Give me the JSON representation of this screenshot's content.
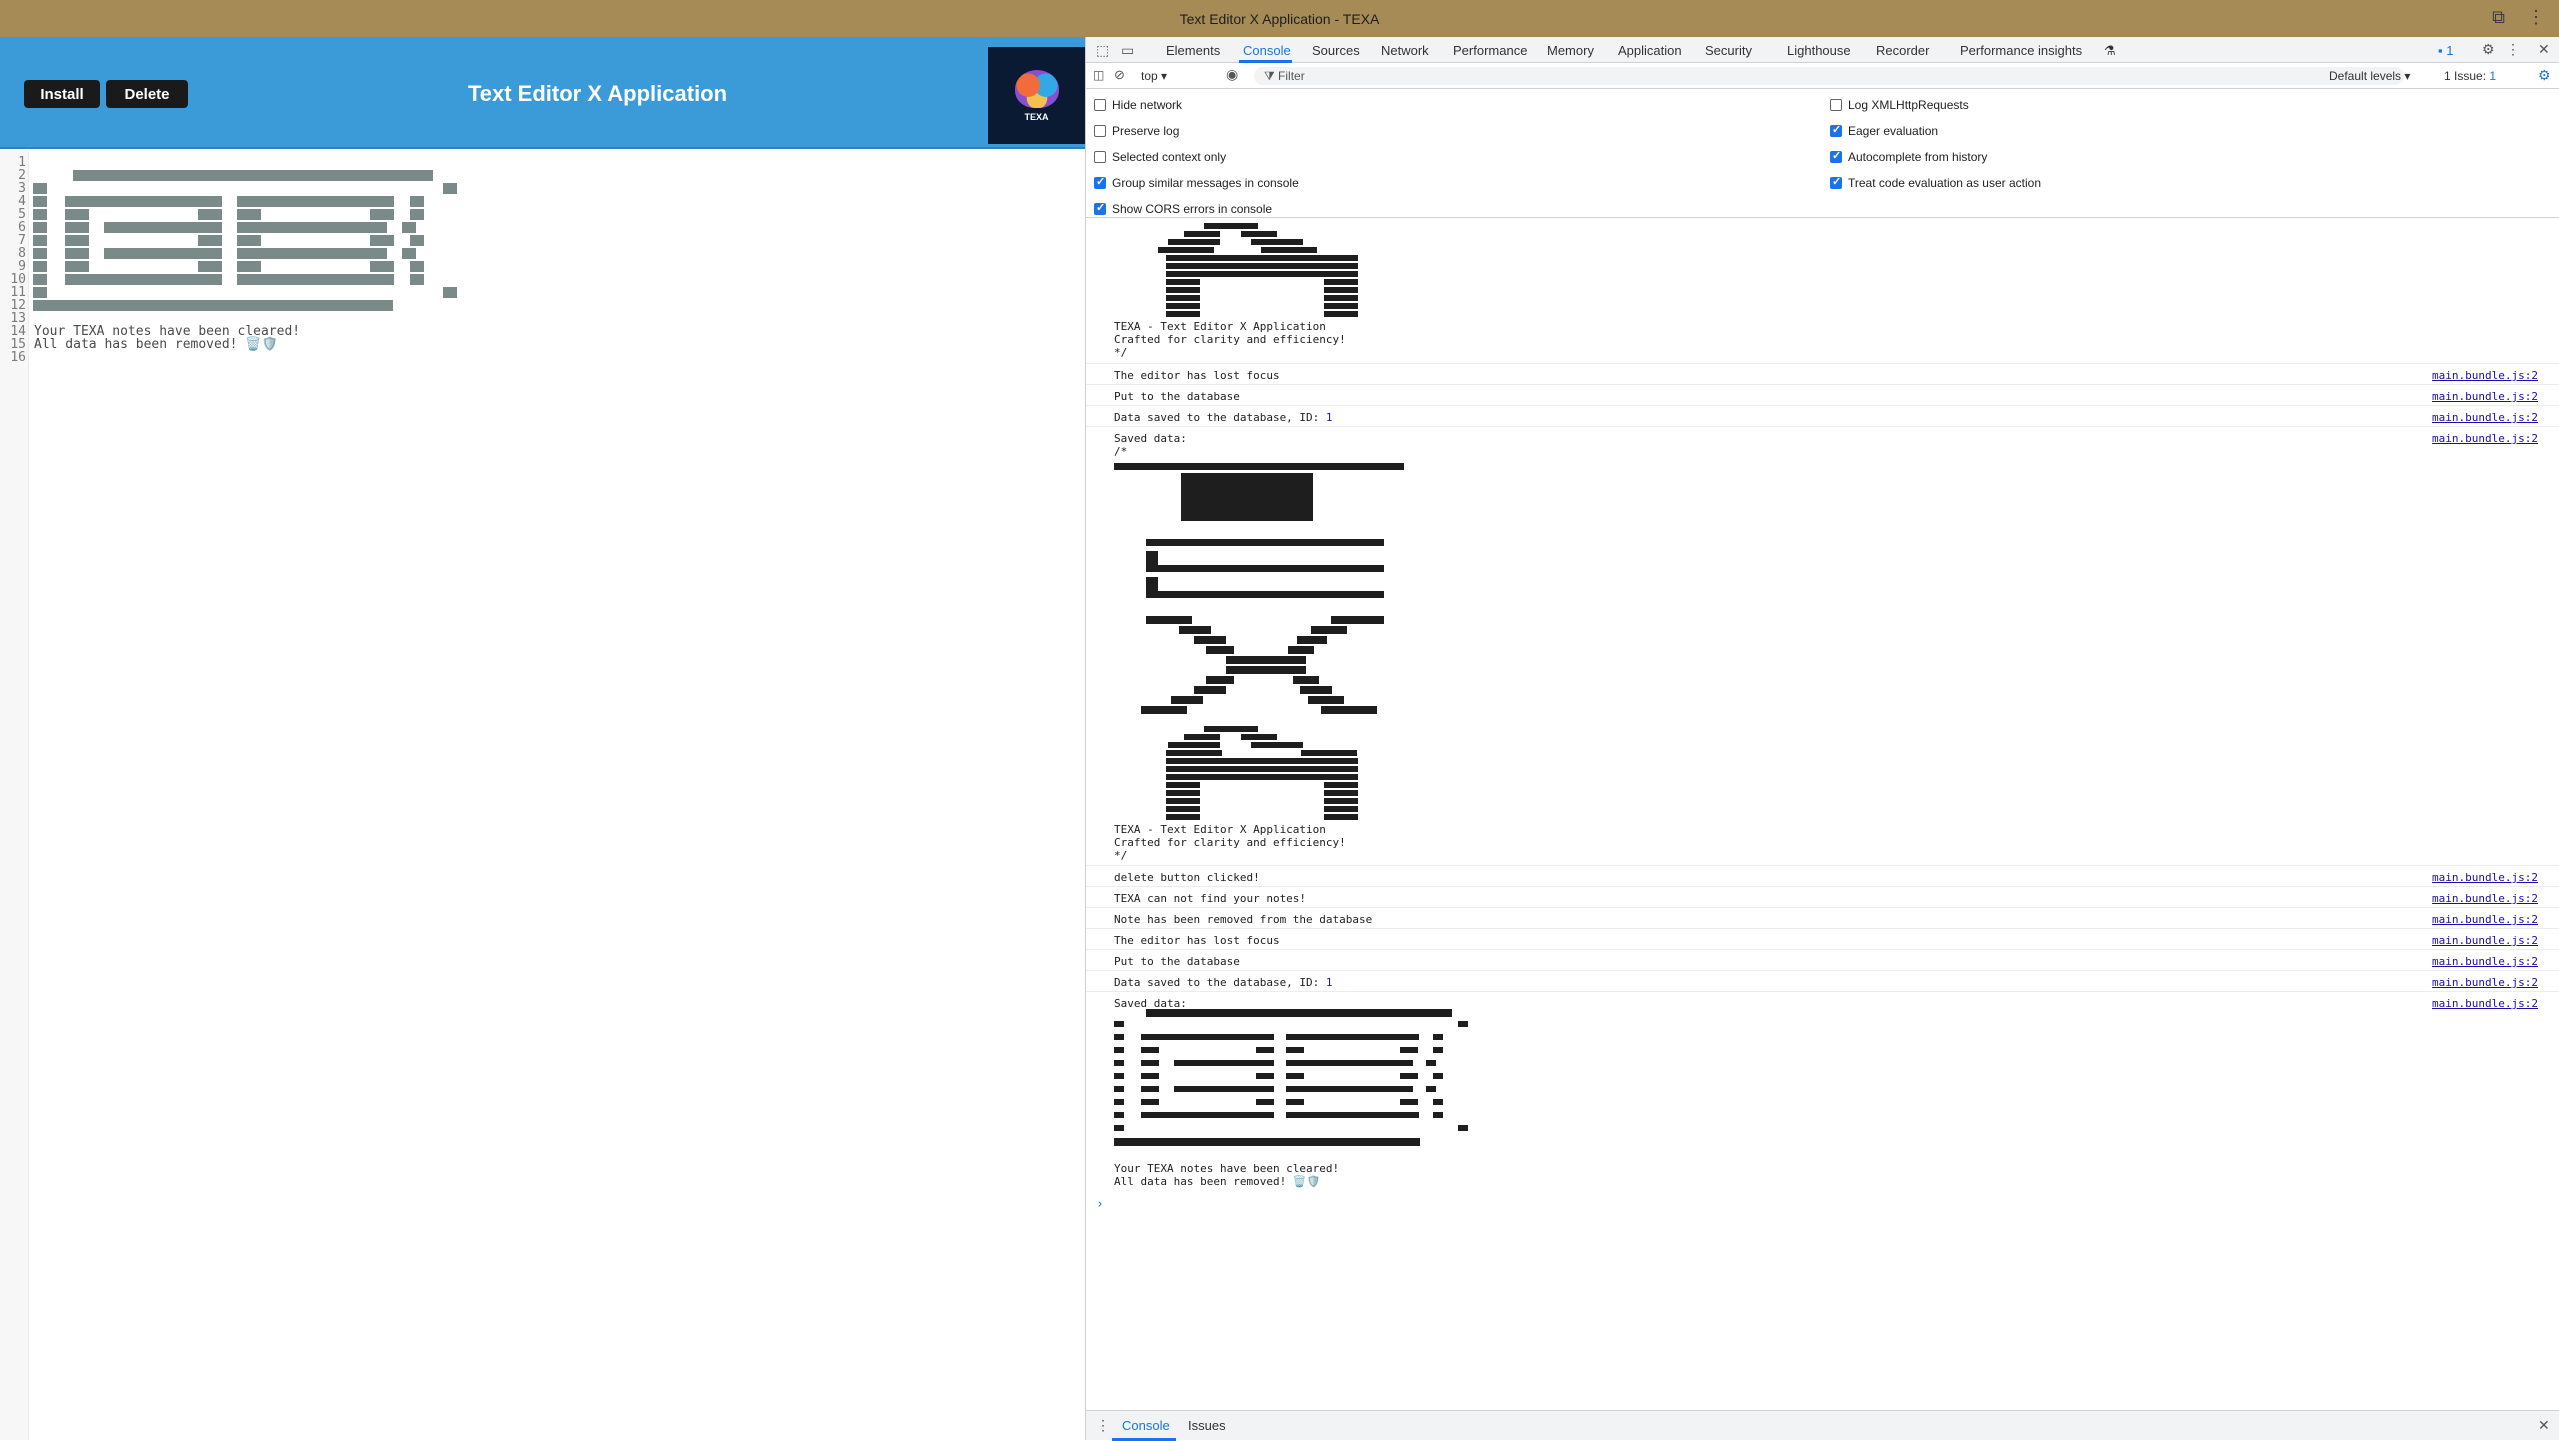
{
  "window": {
    "title": "Text Editor X Application - TEXA"
  },
  "app": {
    "install_label": "Install",
    "delete_label": "Delete",
    "title": "Text Editor X Application",
    "logo_text": "TEXA"
  },
  "editor": {
    "line_numbers": [
      "1",
      "2",
      "3",
      "4",
      "5",
      "6",
      "7",
      "8",
      "9",
      "10",
      "11",
      "12",
      "13",
      "14",
      "15",
      "16"
    ],
    "line14": "Your TEXA notes have been cleared!",
    "line15": "All data has been removed! 🗑️🛡️"
  },
  "devtools": {
    "tabs": [
      "Elements",
      "Console",
      "Sources",
      "Network",
      "Performance",
      "Memory",
      "Application",
      "Security",
      "Lighthouse",
      "Recorder",
      "Performance insights"
    ],
    "issues_badge": "1",
    "context": "top",
    "filter_placeholder": "Filter",
    "levels": "Default levels",
    "issues_summary": "1 Issue:",
    "issues_count": "1",
    "settings_left": [
      {
        "label": "Hide network",
        "checked": false
      },
      {
        "label": "Preserve log",
        "checked": false
      },
      {
        "label": "Selected context only",
        "checked": false
      },
      {
        "label": "Group similar messages in console",
        "checked": true
      },
      {
        "label": "Show CORS errors in console",
        "checked": true
      }
    ],
    "settings_right": [
      {
        "label": "Log XMLHttpRequests",
        "checked": false
      },
      {
        "label": "Eager evaluation",
        "checked": true
      },
      {
        "label": "Autocomplete from history",
        "checked": true
      },
      {
        "label": "Treat code evaluation as user action",
        "checked": true
      }
    ],
    "banner": "TEXA - Text Editor X Application\nCrafted for clarity and efficiency!\n*/",
    "msg_lost_focus": "The editor has lost focus",
    "msg_put": "Put to the database",
    "msg_saved_prefix": "Data saved to the database, ID: ",
    "msg_saved_id": "1",
    "msg_saved_data": "Saved data:\n/*",
    "msg_banner2": "TEXA - Text Editor X Application\nCrafted for clarity and efficiency!\n*/",
    "msg_delete_clicked": "delete button clicked!",
    "msg_not_find": "TEXA can not find your notes!",
    "msg_removed": "Note has been removed from the database",
    "msg_lost_focus2": "The editor has lost focus",
    "msg_put2": "Put to the database",
    "msg_saved2_prefix": "Data saved to the database, ID: ",
    "msg_saved2_id": "1",
    "msg_saved_data2": "Saved data:",
    "msg_final": "Your TEXA notes have been cleared!\nAll data has been removed! 🗑️🛡️",
    "source": "main.bundle.js:2",
    "prompt": "›",
    "drawer_tabs": [
      "Console",
      "Issues"
    ]
  }
}
